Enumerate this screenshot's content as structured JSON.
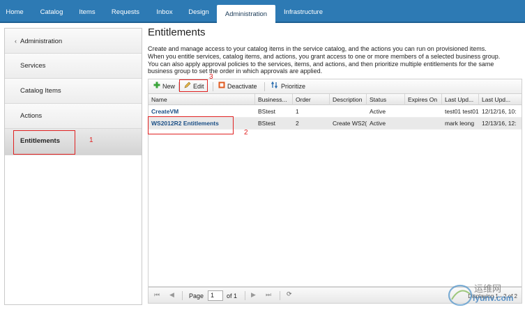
{
  "nav": {
    "tabs": [
      "Home",
      "Catalog",
      "Items",
      "Requests",
      "Inbox",
      "Design",
      "Administration",
      "Infrastructure"
    ],
    "active": "Administration"
  },
  "sidebar": {
    "header": "Administration",
    "items": [
      "Services",
      "Catalog Items",
      "Actions",
      "Entitlements"
    ],
    "selected": "Entitlements"
  },
  "page": {
    "title": "Entitlements",
    "description_lines": [
      "Create and manage access to your catalog items in the service catalog, and the actions you can run on provisioned items.",
      "When you entitle services, catalog items, and actions, you grant access to one or more members of a selected business group.",
      "You can also apply approval policies to the services, items, and actions, and then prioritize multiple entitlements for the same",
      "business group to set the order in which approvals are applied."
    ]
  },
  "toolbar": {
    "new_label": "New",
    "edit_label": "Edit",
    "deactivate_label": "Deactivate",
    "prioritize_label": "Prioritize"
  },
  "grid": {
    "columns": [
      "Name",
      "Business...",
      "Order",
      "Description",
      "Status",
      "Expires On",
      "Last Upd...",
      "Last Upd..."
    ],
    "rows": [
      [
        "CreateVM",
        "BStest",
        "1",
        "",
        "Active",
        "",
        "test01 test01",
        "12/12/16, 10:"
      ],
      [
        "WS2012R2 Entitlements",
        "BStest",
        "2",
        "Create WS2(",
        "Active",
        "",
        "mark leong",
        "12/13/16, 12:"
      ]
    ]
  },
  "pager": {
    "page_label": "Page",
    "page_value": "1",
    "of_label": "of 1",
    "display_text": "Displaying 1 - 2 of 2"
  },
  "annotations": {
    "n1": "1",
    "n2": "2",
    "n3": "3",
    "color": "#e02020"
  },
  "watermark": {
    "cn": "运维网",
    "url": "iyunv.com"
  }
}
